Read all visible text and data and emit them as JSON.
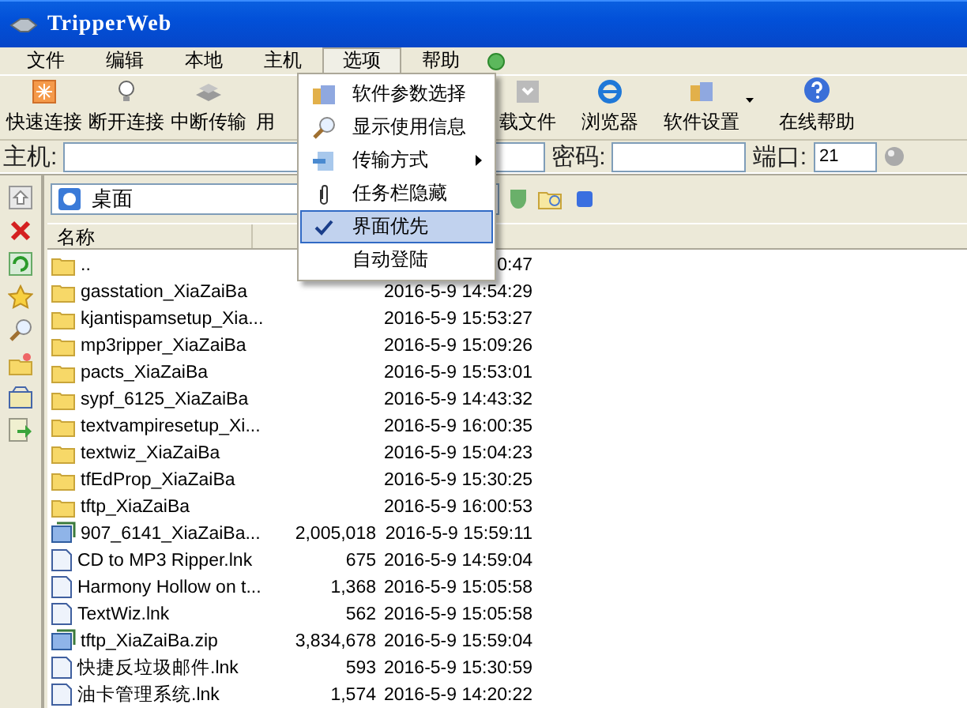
{
  "window": {
    "title": "TripperWeb"
  },
  "menu_bar": [
    {
      "label": "文件",
      "selected": false
    },
    {
      "label": "编辑",
      "selected": false
    },
    {
      "label": "本地",
      "selected": false
    },
    {
      "label": "主机",
      "selected": false
    },
    {
      "label": "选项",
      "selected": true
    },
    {
      "label": "帮助",
      "selected": false
    }
  ],
  "toolbar": {
    "left": [
      "快速连接",
      "断开连接",
      "中断传输",
      "用"
    ],
    "right": [
      {
        "label": "载文件",
        "dropdown": false
      },
      {
        "label": "浏览器",
        "dropdown": false
      },
      {
        "label": "软件设置",
        "dropdown": true
      },
      {
        "label": "在线帮助",
        "dropdown": false
      }
    ]
  },
  "connection_bar": [
    {
      "label": "主机:"
    },
    {
      "label": "密码:"
    },
    {
      "label": "端口:",
      "value": "21"
    }
  ],
  "path": {
    "value": "桌面"
  },
  "table": {
    "columns": [
      "名称"
    ],
    "rows": [
      {
        "kind": "folder",
        "name": "..",
        "date": "0:47"
      },
      {
        "kind": "folder",
        "name": "gasstation_XiaZaiBa",
        "date": "2016-5-9 14:54:29"
      },
      {
        "kind": "folder",
        "name": "kjantispamsetup_Xia...",
        "date": "2016-5-9 15:53:27"
      },
      {
        "kind": "folder",
        "name": "mp3ripper_XiaZaiBa",
        "date": "2016-5-9 15:09:26"
      },
      {
        "kind": "folder",
        "name": "pacts_XiaZaiBa",
        "date": "2016-5-9 15:53:01"
      },
      {
        "kind": "folder",
        "name": "sypf_6125_XiaZaiBa",
        "date": "2016-5-9 14:43:32"
      },
      {
        "kind": "folder",
        "name": "textvampiresetup_Xi...",
        "date": "2016-5-9 16:00:35"
      },
      {
        "kind": "folder",
        "name": "textwiz_XiaZaiBa",
        "date": "2016-5-9 15:04:23"
      },
      {
        "kind": "folder",
        "name": "tfEdProp_XiaZaiBa",
        "date": "2016-5-9 15:30:25"
      },
      {
        "kind": "folder",
        "name": "tftp_XiaZaiBa",
        "date": "2016-5-9 16:00:53"
      },
      {
        "kind": "archive",
        "name": "907_6141_XiaZaiBa...",
        "size": "2,005,018",
        "date": "2016-5-9 15:59:11"
      },
      {
        "kind": "shortcut",
        "name": "CD to MP3 Ripper.lnk",
        "size": "675",
        "date": "2016-5-9 14:59:04"
      },
      {
        "kind": "shortcut",
        "name": "Harmony Hollow on t...",
        "size": "1,368",
        "date": "2016-5-9 15:05:58"
      },
      {
        "kind": "shortcut",
        "name": "TextWiz.lnk",
        "size": "562",
        "date": "2016-5-9 15:05:58"
      },
      {
        "kind": "archive",
        "name": "tftp_XiaZaiBa.zip",
        "size": "3,834,678",
        "date": "2016-5-9 15:59:04"
      },
      {
        "kind": "shortcut",
        "name": "快捷反垃圾邮件.lnk",
        "size": "593",
        "date": "2016-5-9 15:30:59"
      },
      {
        "kind": "shortcut",
        "name": "油卡管理系统.lnk",
        "size": "1,574",
        "date": "2016-5-9 14:20:22"
      }
    ]
  },
  "options_menu": [
    {
      "label": "软件参数选择",
      "checked": false,
      "submenu": false,
      "selected": false
    },
    {
      "label": "显示使用信息",
      "checked": false,
      "submenu": false,
      "selected": false
    },
    {
      "label": "传输方式",
      "checked": false,
      "submenu": true,
      "selected": false
    },
    {
      "label": "任务栏隐藏",
      "checked": false,
      "submenu": false,
      "selected": false
    },
    {
      "label": "界面优先",
      "checked": true,
      "submenu": false,
      "selected": true
    },
    {
      "label": "自动登陆",
      "checked": false,
      "submenu": false,
      "selected": false
    }
  ]
}
